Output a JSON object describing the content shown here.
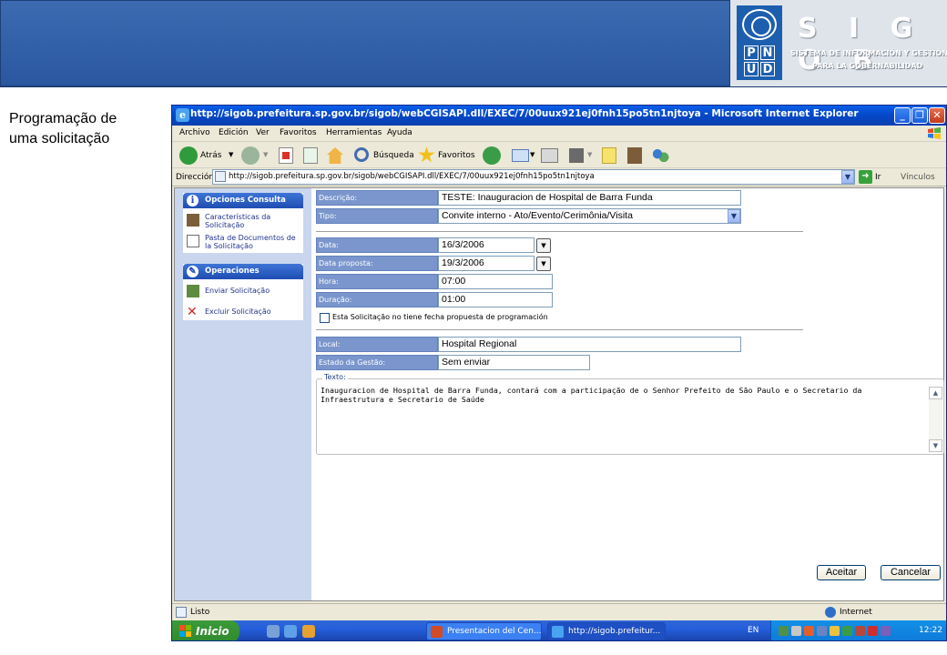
{
  "slide": {
    "title_line1": "Programação de",
    "title_line2": "uma solicitação"
  },
  "logo": {
    "name": "S I G O B",
    "subtitle_line1": "SISTEMA DE INFORMACIÓN Y GESTIÓN",
    "subtitle_line2": "PARA LA GOBERNABILIDAD",
    "pnud": [
      "P",
      "N",
      "U",
      "D"
    ]
  },
  "browser": {
    "title": "http://sigob.prefeitura.sp.gov.br/sigob/webCGISAPI.dll/EXEC/7/00uux921ej0fnh15po5tn1njtoya - Microsoft Internet Explorer",
    "menu": [
      "Archivo",
      "Edición",
      "Ver",
      "Favoritos",
      "Herramientas",
      "Ayuda"
    ],
    "toolbar": {
      "back": "Atrás",
      "search": "Búsqueda",
      "favorites": "Favoritos"
    },
    "address_label": "Dirección",
    "address": "http://sigob.prefeitura.sp.gov.br/sigob/webCGISAPI.dll/EXEC/7/00uux921ej0fnh15po5tn1njtoya",
    "go_label": "Ir",
    "links_label": "Vínculos",
    "status": "Listo",
    "zone": "Internet"
  },
  "sidebar": {
    "consulta": {
      "header": "Opciones Consulta",
      "items": [
        "Características da Solicitação",
        "Pasta de Documentos de la Solicitação"
      ]
    },
    "operaciones": {
      "header": "Operaciones",
      "items": [
        "Enviar Solicitação",
        "Excluir Solicitação"
      ]
    }
  },
  "form": {
    "descricao_label": "Descrição:",
    "descricao_value": "TESTE: Inauguracion de Hospital de Barra Funda",
    "tipo_label": "Tipo:",
    "tipo_value": "Convite interno - Ato/Evento/Cerimônia/Visita",
    "data_label": "Data:",
    "data_value": "16/3/2006",
    "data_proposta_label": "Data proposta:",
    "data_proposta_value": "19/3/2006",
    "hora_label": "Hora:",
    "hora_value": "07:00",
    "duracao_label": "Duração:",
    "duracao_value": "01:00",
    "checkbox_label": "Esta Solicitação no tiene fecha propuesta de programación",
    "checkbox_checked": false,
    "local_label": "Local:",
    "local_value": "Hospital Regional",
    "estado_label": "Estado da Gestão:",
    "estado_value": "Sem enviar",
    "texto_label": "Texto:",
    "texto_value": "Inauguracion de Hospital de Barra Funda, contará com a participação de o Senhor Prefeito de São Paulo e o Secretario da Infraestrutura e Secretario de Saúde",
    "accept_label": "Aceitar",
    "cancel_label": "Cancelar"
  },
  "taskbar": {
    "start": "Inicio",
    "tasks": [
      "Presentacion del Cen...",
      "http://sigob.prefeitur..."
    ],
    "lang": "EN",
    "clock": "12:22"
  }
}
